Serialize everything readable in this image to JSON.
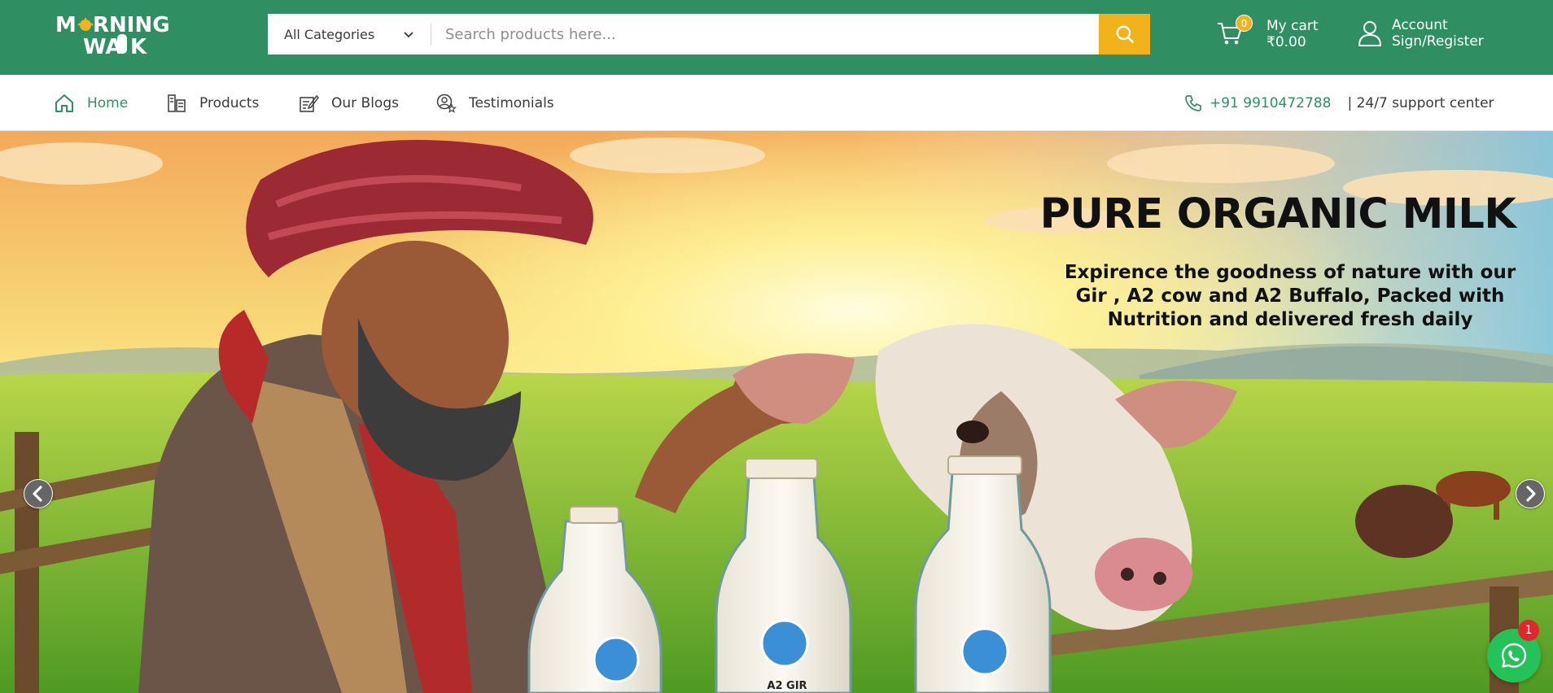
{
  "brand": {
    "logo_line1": "MORNING",
    "logo_line2": "WALK",
    "primary_color": "#2f8f63",
    "accent_color": "#f2b21b"
  },
  "search": {
    "category_selected": "All Categories",
    "placeholder": "Search products here...",
    "button_icon": "search-icon"
  },
  "cart": {
    "count": "0",
    "label": "My cart",
    "total": "₹0.00"
  },
  "account": {
    "label": "Account",
    "sub_label": "Sign/Register"
  },
  "nav": {
    "items": [
      {
        "label": "Home",
        "icon": "home-icon",
        "active": true
      },
      {
        "label": "Products",
        "icon": "products-icon",
        "active": false
      },
      {
        "label": "Our Blogs",
        "icon": "blog-icon",
        "active": false
      },
      {
        "label": "Testimonials",
        "icon": "testimonials-icon",
        "active": false
      }
    ],
    "phone": "+91 9910472788",
    "support_text": "| 24/7 support center"
  },
  "hero": {
    "title": "PURE ORGANIC MILK",
    "subtitle": "Expirence the goodness of nature with our Gir , A2 cow and A2 Buffalo, Packed with Nutrition and delivered fresh daily",
    "bottle_label": "A2 GIR"
  },
  "whatsapp": {
    "badge_count": "1",
    "icon": "whatsapp-icon"
  }
}
